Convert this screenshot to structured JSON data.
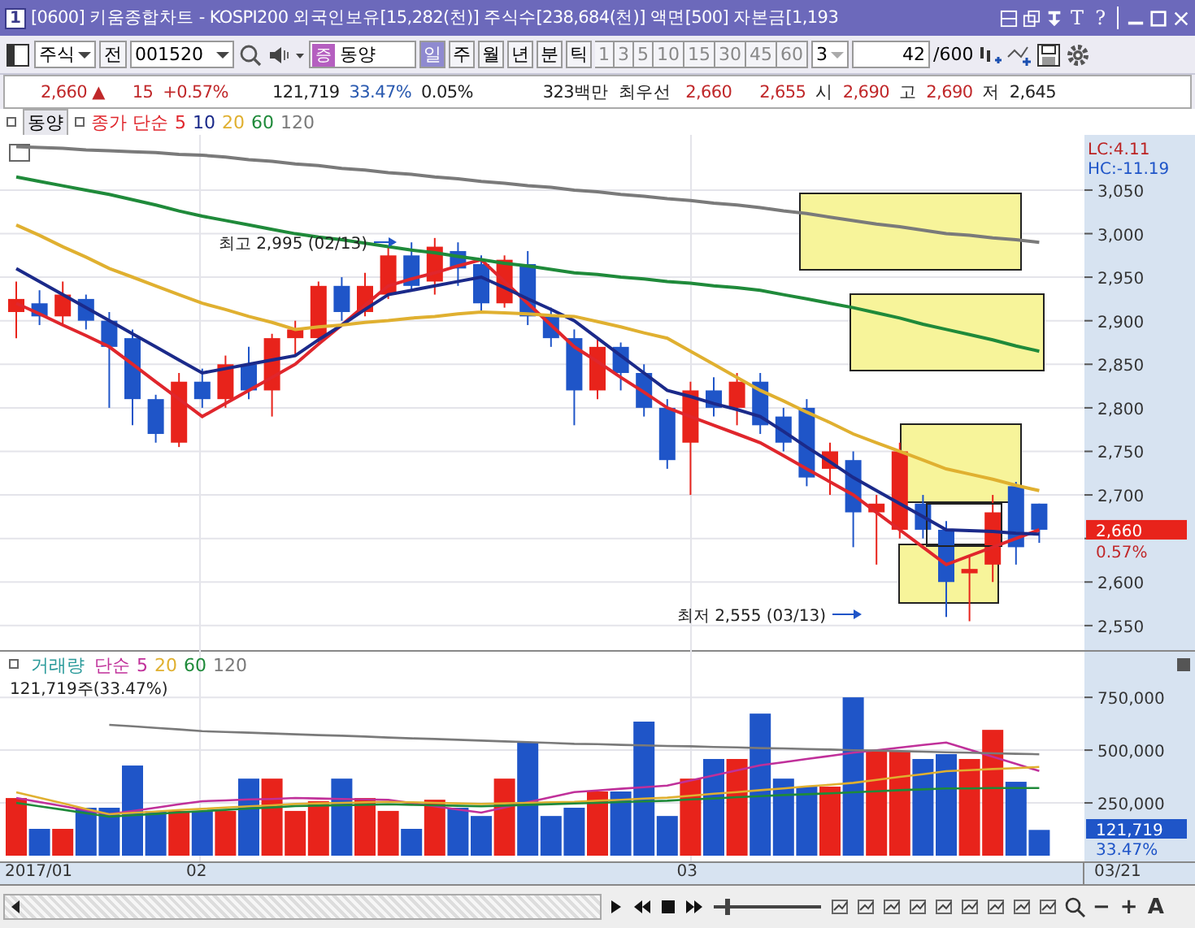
{
  "window": {
    "number": "1",
    "title": "[0600] 키움종합차트 - KOSPI200 외국인보유[15,282(천)] 주식수[238,684(천)] 액면[500] 자본금[1,193",
    "text_buttons": [
      "T",
      "?"
    ]
  },
  "toolbar": {
    "market": "주식",
    "all_button": "전",
    "code": "001520",
    "badge": "증",
    "name": "동양",
    "periods": [
      {
        "label": "일",
        "selected": true
      },
      {
        "label": "주",
        "selected": false
      },
      {
        "label": "월",
        "selected": false
      },
      {
        "label": "년",
        "selected": false
      },
      {
        "label": "분",
        "selected": false
      },
      {
        "label": "틱",
        "selected": false
      }
    ],
    "intervals": [
      "1",
      "3",
      "5",
      "10",
      "15",
      "30",
      "45",
      "60"
    ],
    "interval_select": "3",
    "count": "42",
    "count_max": "/600"
  },
  "quote": [
    {
      "text": "2,660",
      "kind": "up"
    },
    {
      "text": "▲",
      "kind": "up"
    },
    {
      "text": "15",
      "kind": "up"
    },
    {
      "text": "+0.57%",
      "kind": "up"
    },
    {
      "text": "121,719",
      "kind": "plain"
    },
    {
      "text": "33.47%",
      "kind": "ratio"
    },
    {
      "text": "0.05%",
      "kind": "plain"
    },
    {
      "text": "323백만",
      "kind": "plain"
    },
    {
      "text": "최우선",
      "kind": "plain"
    },
    {
      "text": "2,660",
      "kind": "up"
    },
    {
      "text": "2,655",
      "kind": "up"
    },
    {
      "text": "시",
      "kind": "plain"
    },
    {
      "text": "2,690",
      "kind": "up"
    },
    {
      "text": "고",
      "kind": "plain"
    },
    {
      "text": "2,690",
      "kind": "up"
    },
    {
      "text": "저",
      "kind": "plain"
    },
    {
      "text": "2,645",
      "kind": "plain"
    }
  ],
  "price_panel": {
    "stock_label": "동양",
    "legend_prefix": "종가 단순",
    "lc": "LC:4.11",
    "hc": "HC:-11.19",
    "last_price": "2,660",
    "last_change": "0.57%",
    "chart_data": {
      "type": "candlestick",
      "grid": true,
      "ylim": [
        2520,
        3110
      ],
      "yticks": [
        {
          "value": 2550,
          "label": "2,550"
        },
        {
          "value": 2600,
          "label": "2,600"
        },
        {
          "value": 2700,
          "label": "2,700"
        },
        {
          "value": 2750,
          "label": "2,750"
        },
        {
          "value": 2800,
          "label": "2,800"
        },
        {
          "value": 2850,
          "label": "2,850"
        },
        {
          "value": 2900,
          "label": "2,900"
        },
        {
          "value": 2950,
          "label": "2,950"
        },
        {
          "value": 3000,
          "label": "3,000"
        },
        {
          "value": 3050,
          "label": "3,050"
        }
      ],
      "ohlc": [
        [
          2910,
          2945,
          2880,
          2925
        ],
        [
          2920,
          2935,
          2895,
          2905
        ],
        [
          2905,
          2945,
          2895,
          2930
        ],
        [
          2925,
          2930,
          2890,
          2900
        ],
        [
          2900,
          2910,
          2800,
          2870
        ],
        [
          2880,
          2890,
          2780,
          2810
        ],
        [
          2810,
          2815,
          2760,
          2770
        ],
        [
          2760,
          2840,
          2755,
          2830
        ],
        [
          2830,
          2845,
          2800,
          2810
        ],
        [
          2810,
          2860,
          2800,
          2850
        ],
        [
          2850,
          2870,
          2810,
          2820
        ],
        [
          2820,
          2885,
          2790,
          2880
        ],
        [
          2880,
          2900,
          2860,
          2890
        ],
        [
          2880,
          2945,
          2875,
          2940
        ],
        [
          2940,
          2950,
          2900,
          2910
        ],
        [
          2910,
          2955,
          2905,
          2940
        ],
        [
          2930,
          2985,
          2925,
          2975
        ],
        [
          2975,
          2990,
          2935,
          2940
        ],
        [
          2945,
          2995,
          2930,
          2985
        ],
        [
          2980,
          2990,
          2940,
          2960
        ],
        [
          2965,
          2975,
          2910,
          2920
        ],
        [
          2920,
          2975,
          2915,
          2970
        ],
        [
          2965,
          2980,
          2895,
          2905
        ],
        [
          2905,
          2915,
          2870,
          2880
        ],
        [
          2880,
          2890,
          2780,
          2820
        ],
        [
          2820,
          2880,
          2810,
          2870
        ],
        [
          2870,
          2875,
          2820,
          2840
        ],
        [
          2840,
          2850,
          2790,
          2800
        ],
        [
          2800,
          2810,
          2730,
          2740
        ],
        [
          2760,
          2830,
          2700,
          2820
        ],
        [
          2820,
          2835,
          2790,
          2800
        ],
        [
          2800,
          2840,
          2780,
          2830
        ],
        [
          2830,
          2840,
          2770,
          2780
        ],
        [
          2790,
          2800,
          2750,
          2760
        ],
        [
          2800,
          2810,
          2710,
          2720
        ],
        [
          2730,
          2760,
          2700,
          2750
        ],
        [
          2740,
          2750,
          2640,
          2680
        ],
        [
          2680,
          2700,
          2620,
          2690
        ],
        [
          2660,
          2760,
          2650,
          2750
        ],
        [
          2690,
          2700,
          2650,
          2660
        ],
        [
          2660,
          2670,
          2560,
          2600
        ],
        [
          2610,
          2630,
          2555,
          2615
        ],
        [
          2620,
          2700,
          2600,
          2680
        ],
        [
          2710,
          2715,
          2620,
          2640
        ],
        [
          2690,
          2690,
          2645,
          2660
        ]
      ],
      "series": [
        {
          "name": "5",
          "type": "line",
          "color": "#e0262c",
          "values": [
            2920,
            2908,
            2895,
            2883,
            2870,
            2850,
            2830,
            2810,
            2790,
            2805,
            2820,
            2835,
            2850,
            2873,
            2895,
            2918,
            2940,
            2948,
            2955,
            2963,
            2970,
            2945,
            2920,
            2895,
            2870,
            2853,
            2835,
            2818,
            2800,
            2790,
            2780,
            2770,
            2760,
            2745,
            2730,
            2715,
            2700,
            2680,
            2660,
            2640,
            2620,
            2630,
            2640,
            2650,
            2660
          ]
        },
        {
          "name": "10",
          "type": "line",
          "color": "#1b2a8a",
          "values": [
            2960,
            2945,
            2930,
            2915,
            2900,
            2885,
            2870,
            2855,
            2840,
            2845,
            2850,
            2855,
            2860,
            2878,
            2895,
            2913,
            2930,
            2935,
            2940,
            2945,
            2950,
            2938,
            2925,
            2913,
            2900,
            2880,
            2860,
            2840,
            2820,
            2813,
            2805,
            2798,
            2790,
            2773,
            2755,
            2738,
            2720,
            2705,
            2690,
            2675,
            2660,
            2659,
            2658,
            2656,
            2655
          ]
        },
        {
          "name": "20",
          "type": "line",
          "color": "#e0b030",
          "values": [
            3010,
            2998,
            2985,
            2973,
            2960,
            2950,
            2940,
            2930,
            2920,
            2913,
            2905,
            2898,
            2890,
            2893,
            2895,
            2898,
            2900,
            2903,
            2905,
            2908,
            2910,
            2909,
            2908,
            2906,
            2905,
            2899,
            2893,
            2886,
            2880,
            2865,
            2850,
            2835,
            2820,
            2808,
            2795,
            2783,
            2770,
            2760,
            2750,
            2740,
            2730,
            2724,
            2718,
            2711,
            2705
          ]
        },
        {
          "name": "60",
          "type": "line",
          "color": "#1f8a3a",
          "values": [
            3065,
            3060,
            3055,
            3050,
            3045,
            3039,
            3033,
            3026,
            3020,
            3015,
            3010,
            3005,
            3000,
            2996,
            2993,
            2989,
            2985,
            2981,
            2978,
            2974,
            2970,
            2966,
            2963,
            2959,
            2955,
            2953,
            2950,
            2948,
            2945,
            2943,
            2940,
            2938,
            2935,
            2930,
            2925,
            2920,
            2915,
            2909,
            2903,
            2896,
            2890,
            2884,
            2878,
            2871,
            2865
          ]
        },
        {
          "name": "120",
          "type": "line",
          "color": "#7a7a7a",
          "values": [
            3100,
            3099,
            3098,
            3096,
            3095,
            3094,
            3093,
            3091,
            3090,
            3088,
            3085,
            3083,
            3080,
            3078,
            3075,
            3073,
            3070,
            3068,
            3065,
            3063,
            3060,
            3058,
            3055,
            3053,
            3050,
            3048,
            3045,
            3043,
            3040,
            3038,
            3035,
            3033,
            3030,
            3026,
            3023,
            3019,
            3015,
            3011,
            3008,
            3004,
            3000,
            2998,
            2995,
            2993,
            2990
          ]
        }
      ],
      "annotations": [
        "최고 2,995 (02/13)",
        "최저 2,555 (03/13)"
      ]
    }
  },
  "volume_panel": {
    "legend_label": "거래량",
    "legend_prefix": "단순",
    "info": "121,719주(33.47%)",
    "last_volume": "121,719",
    "last_ratio": "33.47%",
    "chart_data": {
      "type": "bar",
      "grid": true,
      "ylim": [
        0,
        970000
      ],
      "yticks": [
        {
          "value": 250000,
          "label": "250,000"
        },
        {
          "value": 500000,
          "label": "500,000"
        },
        {
          "value": 750000,
          "label": "750,000"
        }
      ],
      "series": [
        {
          "color": "#e8231b",
          "values": [
            273000,
            null,
            127000,
            null,
            null,
            null,
            null,
            212000,
            null,
            212000,
            null,
            365000,
            212000,
            258000,
            null,
            273000,
            212000,
            null,
            265000,
            null,
            null,
            365000,
            null,
            null,
            null,
            304000,
            null,
            null,
            null,
            365000,
            null,
            458000,
            null,
            null,
            null,
            327000,
            null,
            496000,
            496000,
            null,
            null,
            458000,
            596000,
            null,
            null
          ]
        },
        {
          "color": "#1f55c8",
          "values": [
            null,
            127000,
            null,
            227000,
            227000,
            427000,
            212000,
            null,
            212000,
            null,
            365000,
            null,
            null,
            null,
            365000,
            null,
            null,
            127000,
            null,
            227000,
            188000,
            null,
            535000,
            188000,
            227000,
            null,
            304000,
            635000,
            188000,
            null,
            458000,
            null,
            673000,
            365000,
            327000,
            null,
            750000,
            null,
            null,
            458000,
            481000,
            null,
            null,
            350000,
            122000
          ]
        },
        {
          "name": "5",
          "type": "line",
          "color": "#c0309a",
          "values": [
            273000,
            254000,
            235000,
            215000,
            196000,
            212000,
            227000,
            243000,
            258000,
            262000,
            266000,
            269000,
            273000,
            271000,
            269000,
            266000,
            264000,
            249000,
            234000,
            219000,
            204000,
            228000,
            253000,
            277000,
            301000,
            309000,
            317000,
            324000,
            332000,
            356000,
            380000,
            404000,
            428000,
            443000,
            458000,
            473000,
            488000,
            500000,
            512000,
            524000,
            536000,
            502000,
            469000,
            435000,
            401000
          ]
        },
        {
          "name": "20",
          "type": "line",
          "color": "#e0b030",
          "values": [
            300000,
            274000,
            248000,
            222000,
            196000,
            203000,
            209000,
            216000,
            222000,
            228000,
            234000,
            239000,
            245000,
            248000,
            250000,
            253000,
            255000,
            253000,
            250000,
            248000,
            245000,
            248000,
            250000,
            253000,
            255000,
            260000,
            265000,
            270000,
            275000,
            284000,
            293000,
            301000,
            310000,
            319000,
            328000,
            336000,
            345000,
            359000,
            373000,
            386000,
            400000,
            405000,
            410000,
            415000,
            420000
          ]
        },
        {
          "name": "60",
          "type": "line",
          "color": "#1f8a3a",
          "values": [
            250000,
            234000,
            218000,
            201000,
            185000,
            192000,
            198000,
            205000,
            211000,
            217000,
            223000,
            229000,
            235000,
            237000,
            239000,
            241000,
            243000,
            241000,
            239000,
            236000,
            234000,
            237000,
            241000,
            244000,
            247000,
            250000,
            254000,
            257000,
            260000,
            266000,
            271000,
            277000,
            282000,
            287000,
            291000,
            296000,
            300000,
            305000,
            310000,
            314000,
            319000,
            319000,
            320000,
            320000,
            320000
          ]
        },
        {
          "name": "120",
          "type": "line",
          "color": "#7a7a7a",
          "values": [
            null,
            null,
            null,
            null,
            620000,
            613000,
            605000,
            598000,
            590000,
            586000,
            583000,
            579000,
            575000,
            571000,
            568000,
            564000,
            560000,
            556000,
            553000,
            549000,
            545000,
            541000,
            538000,
            534000,
            530000,
            528000,
            525000,
            523000,
            520000,
            518000,
            515000,
            513000,
            510000,
            508000,
            505000,
            503000,
            500000,
            498000,
            495000,
            493000,
            490000,
            488000,
            485000,
            483000,
            480000
          ]
        }
      ]
    }
  },
  "x_axis": [
    "2017/01",
    "02",
    "03"
  ],
  "x_axis_end": "03/21",
  "zoom_slider": {
    "level": 0.1
  },
  "bottom_toolbar": [
    "−",
    "+",
    "A"
  ]
}
